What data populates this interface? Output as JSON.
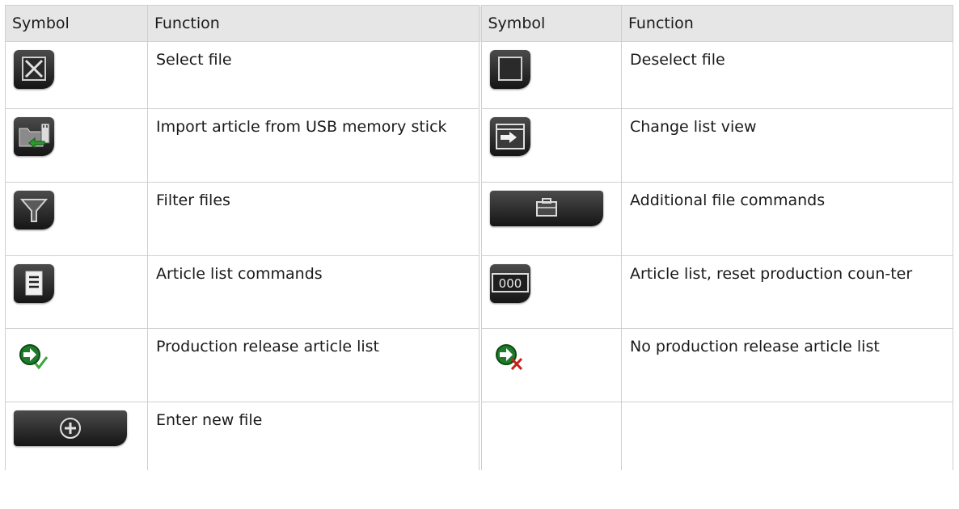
{
  "headers": [
    "Symbol",
    "Function",
    "Symbol",
    "Function"
  ],
  "rows": [
    {
      "left": {
        "icon": "select-file-checkbox-icon",
        "text": "Select file"
      },
      "right": {
        "icon": "deselect-file-checkbox-icon",
        "text": "Deselect file"
      }
    },
    {
      "left": {
        "icon": "usb-import-icon",
        "text": "Import article from USB memory stick"
      },
      "right": {
        "icon": "change-list-view-icon",
        "text": "Change list view"
      }
    },
    {
      "left": {
        "icon": "filter-funnel-icon",
        "text": "Filter files"
      },
      "right": {
        "icon": "briefcase-icon",
        "text": "Additional file commands"
      }
    },
    {
      "left": {
        "icon": "article-list-icon",
        "text": "Article list commands"
      },
      "right": {
        "icon": "counter-000-icon",
        "text": "Article list, reset production coun-ter"
      }
    },
    {
      "left": {
        "icon": "production-release-icon",
        "text": "Production release article list"
      },
      "right": {
        "icon": "no-production-release-icon",
        "text": "No production release article list"
      }
    },
    {
      "left": {
        "icon": "add-plus-icon",
        "text": "Enter new file"
      },
      "right": {
        "icon": "",
        "text": ""
      }
    }
  ],
  "counter_text": "000"
}
